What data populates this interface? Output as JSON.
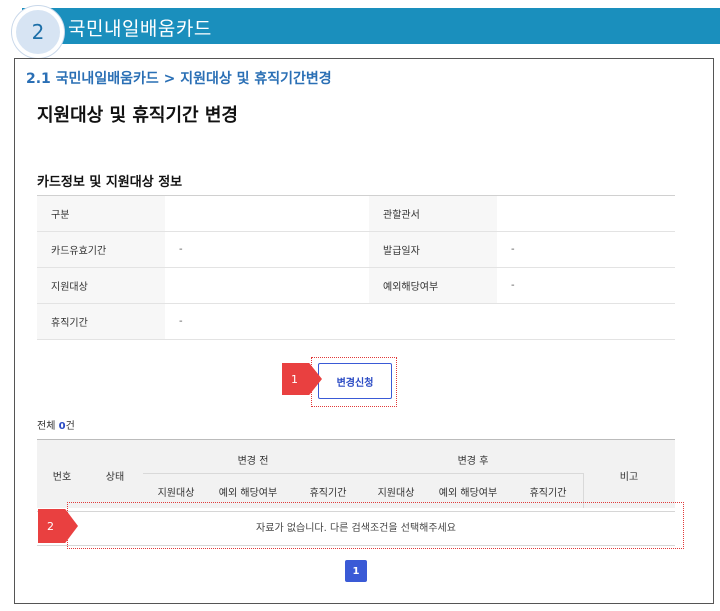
{
  "banner": {
    "number": "2",
    "title": "국민내일배움카드"
  },
  "breadcrumb": "2.1 국민내일배움카드 > 지원대상 및 휴직기간변경",
  "page_title": "지원대상 및 휴직기간 변경",
  "info_section": {
    "title": "카드정보 및 지원대상 정보",
    "rows": [
      {
        "label1": "구분",
        "value1": "",
        "label2": "관할관서",
        "value2": ""
      },
      {
        "label1": "카드유효기간",
        "value1": "-",
        "label2": "발급일자",
        "value2": "-"
      },
      {
        "label1": "지원대상",
        "value1": "",
        "label2": "예외해당여부",
        "value2": "-"
      },
      {
        "label1": "휴직기간",
        "value1": "-",
        "label2": "",
        "value2": ""
      }
    ]
  },
  "apply_button": "변경신청",
  "markers": {
    "m1": "1",
    "m2": "2"
  },
  "total": {
    "prefix": "전체 ",
    "count": "0",
    "suffix": "건"
  },
  "list": {
    "headers": {
      "no": "번호",
      "status": "상태",
      "before": "변경 전",
      "after": "변경 후",
      "note": "비고",
      "before_cols": [
        "지원대상",
        "예외 해당여부",
        "휴직기간"
      ],
      "after_cols": [
        "지원대상",
        "예외 해당여부",
        "휴직기간"
      ]
    },
    "empty_message": "자료가 없습니다. 다른 검색조건을 선택해주세요"
  },
  "pagination": {
    "current": "1"
  },
  "colors": {
    "banner": "#1a8fbd",
    "accent": "#3a5ad6",
    "highlight": "#e94040"
  }
}
